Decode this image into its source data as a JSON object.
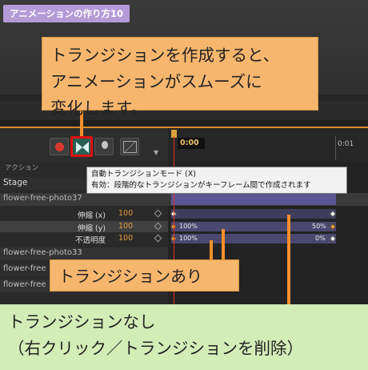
{
  "badge": "アニメーションの作り方10",
  "callout_main": {
    "line1": "トランジションを作成すると、",
    "line2": "アニメーションがスムーズに",
    "line3": "変化します。"
  },
  "timeline": {
    "time_current": "0:00",
    "time_next": "0:01"
  },
  "panel": {
    "header": "アクション",
    "stage": "Stage",
    "layer_selected": "flower-free-photo37",
    "props": [
      {
        "name": "伸縮 (x)",
        "value": "100"
      },
      {
        "name": "伸縮 (y)",
        "value": "100"
      },
      {
        "name": "不透明度",
        "value": "100"
      }
    ],
    "layer2": "flower-free-photo33",
    "layer3": "flower-free",
    "layer4": "flower-free"
  },
  "lanes": {
    "y_start": "100%",
    "y_end": "50%",
    "op_start": "100%",
    "op_end": "0%"
  },
  "tooltip": {
    "title": "自動トランジションモード (X)",
    "desc": "有効：段階的なトランジションがキーフレーム間で作成されます"
  },
  "callout_mid": "トランジションあり",
  "callout_green": {
    "line1": "トランジションなし",
    "line2": "（右クリック／トランジションを削除）"
  },
  "colors": {
    "accent_orange": "#f7b66e",
    "highlight_red": "#e01010",
    "green_note": "#d3edb6",
    "badge_purple": "#b59ad8"
  }
}
